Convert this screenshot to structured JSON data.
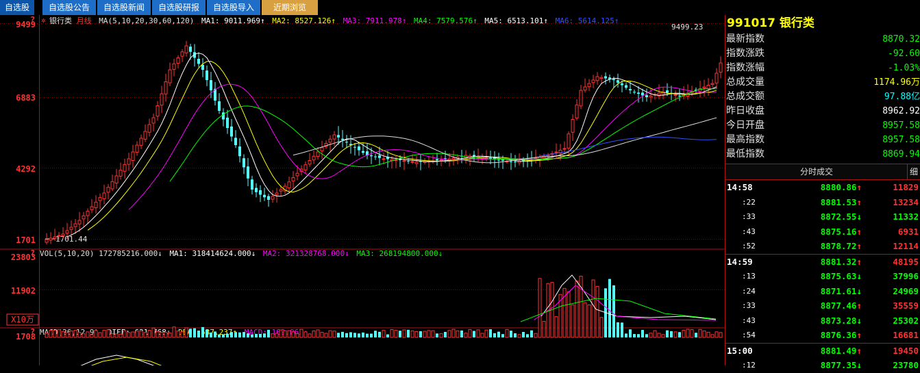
{
  "tabs": [
    {
      "label": "自选股",
      "bg": "#0c55a8"
    },
    {
      "label": "自选股公告",
      "bg": "#1e6dc7"
    },
    {
      "label": "自选股新闻",
      "bg": "#1e6dc7"
    },
    {
      "label": "自选股研报",
      "bg": "#1e6dc7"
    },
    {
      "label": "自选股导入",
      "bg": "#1e6dc7"
    },
    {
      "label": "近期浏览",
      "bg": "#d8a040"
    }
  ],
  "main_header": {
    "name": "银行类",
    "period": "月线",
    "ma_set": "MA(5,10,20,30,60,120)",
    "ma": [
      {
        "label": "MA1: 9011.969↑",
        "color": "#ffffff"
      },
      {
        "label": "MA2: 8527.126↑",
        "color": "#ffff00"
      },
      {
        "label": "MA3: 7911.978↑",
        "color": "#ff00ff"
      },
      {
        "label": "MA4: 7579.576↑",
        "color": "#00ff00"
      },
      {
        "label": "MA5: 6513.101↑",
        "color": "#ffffff"
      },
      {
        "label": "MA6: 5614.125↑",
        "color": "#3050ff"
      }
    ]
  },
  "price_axis": [
    "9499",
    "6883",
    "4292",
    "1701"
  ],
  "annotations": {
    "high": "9499.23",
    "low": "1701.44"
  },
  "vol_header": {
    "label": "VOL(5,10,20) 172785216.000↓",
    "ma": [
      {
        "label": "MA1: 318414624.000↓",
        "color": "#ffffff"
      },
      {
        "label": "MA2: 321328768.000↓",
        "color": "#ff00ff"
      },
      {
        "label": "MA3: 268194800.000↓",
        "color": "#00ff00"
      }
    ]
  },
  "vol_axis": [
    "23803",
    "11902"
  ],
  "vol_unit": "X10万",
  "macd_header": {
    "label": "MACD(26,12,9)",
    "items": [
      {
        "label": "DIFF: 621.768↓",
        "color": "#ffffff"
      },
      {
        "label": "DEA: 537.237↑",
        "color": "#ffff00"
      },
      {
        "label": "MACD: 169.062↓",
        "color": "#ff00ff"
      }
    ]
  },
  "macd_axis": [
    "1708"
  ],
  "colors": {
    "up": "#ff3232",
    "down": "#54ffff",
    "grid": "#8a0000",
    "axis": "#ff3232"
  },
  "quote": {
    "code": "991017",
    "name": "银行类",
    "rows": [
      {
        "label": "最新指数",
        "value": "8870.32",
        "color": "#00ff00"
      },
      {
        "label": "指数涨跌",
        "value": "-92.60",
        "color": "#00ff00"
      },
      {
        "label": "指数涨幅",
        "value": "-1.03%",
        "color": "#00ff00"
      },
      {
        "label": "总成交量",
        "value": "1174.96万",
        "color": "#ffff00"
      },
      {
        "label": "总成交额",
        "value": "97.88亿",
        "color": "#00ffff"
      },
      {
        "label": "昨日收盘",
        "value": "8962.92",
        "color": "#ffffff"
      },
      {
        "label": "今日开盘",
        "value": "8957.58",
        "color": "#00ff00"
      },
      {
        "label": "最高指数",
        "value": "8957.58",
        "color": "#00ff00"
      },
      {
        "label": "最低指数",
        "value": "8869.94",
        "color": "#00ff00"
      }
    ]
  },
  "trades": {
    "header": "分时成交",
    "button": "细",
    "rows": [
      {
        "time": "14:58",
        "price": "8880.86",
        "dir": "↑",
        "vol": "11829",
        "major": true
      },
      {
        "time": ":22",
        "price": "8881.53",
        "dir": "↑",
        "vol": "13234"
      },
      {
        "time": ":33",
        "price": "8872.55",
        "dir": "↓",
        "vol": "11332"
      },
      {
        "time": ":43",
        "price": "8875.16",
        "dir": "↑",
        "vol": "6931"
      },
      {
        "time": ":52",
        "price": "8878.72",
        "dir": "↑",
        "vol": "12114"
      },
      {
        "time": "14:59",
        "price": "8881.32",
        "dir": "↑",
        "vol": "48195",
        "major": true
      },
      {
        "time": ":13",
        "price": "8875.63",
        "dir": "↓",
        "vol": "37996"
      },
      {
        "time": ":24",
        "price": "8871.61",
        "dir": "↓",
        "vol": "24969"
      },
      {
        "time": ":33",
        "price": "8877.46",
        "dir": "↑",
        "vol": "35559"
      },
      {
        "time": ":43",
        "price": "8873.28",
        "dir": "↓",
        "vol": "25302"
      },
      {
        "time": ":54",
        "price": "8876.36",
        "dir": "↑",
        "vol": "16681"
      },
      {
        "time": "15:00",
        "price": "8881.49",
        "dir": "↑",
        "vol": "19450",
        "major": true
      },
      {
        "time": ":12",
        "price": "8877.35",
        "dir": "↓",
        "vol": "23780"
      }
    ]
  }
}
